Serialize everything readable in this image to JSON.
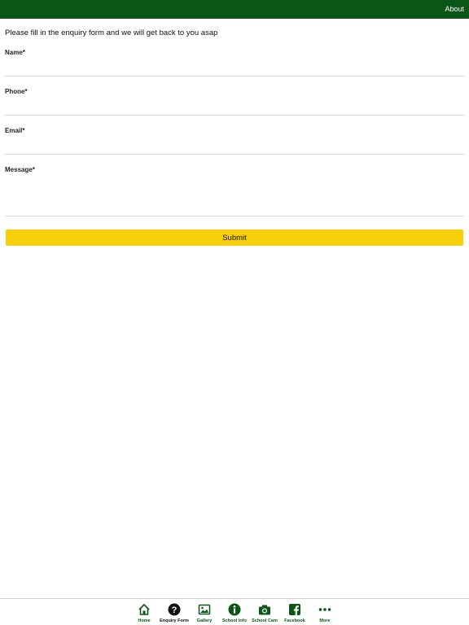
{
  "header": {
    "about_label": "About",
    "background_color": "#0b5616"
  },
  "form": {
    "intro": "Please fill in the enquiry form and we will get back to you asap",
    "fields": [
      {
        "label": "Name*",
        "value": ""
      },
      {
        "label": "Phone*",
        "value": ""
      },
      {
        "label": "Email*",
        "value": ""
      },
      {
        "label": "Message*",
        "value": ""
      }
    ],
    "submit_label": "Submit",
    "submit_color": "#f6cf0a"
  },
  "tabbar": {
    "items": [
      {
        "label": "Home",
        "icon": "home-icon",
        "active": false
      },
      {
        "label": "Enquiry Form",
        "icon": "question-circle-icon",
        "active": true
      },
      {
        "label": "Gallery",
        "icon": "image-icon",
        "active": false
      },
      {
        "label": "School Info",
        "icon": "info-circle-icon",
        "active": false
      },
      {
        "label": "School Cam",
        "icon": "camera-icon",
        "active": false
      },
      {
        "label": "Facebook",
        "icon": "facebook-icon",
        "active": false
      },
      {
        "label": "More",
        "icon": "more-dots-icon",
        "active": false
      }
    ],
    "accent_color": "#0b5616"
  }
}
